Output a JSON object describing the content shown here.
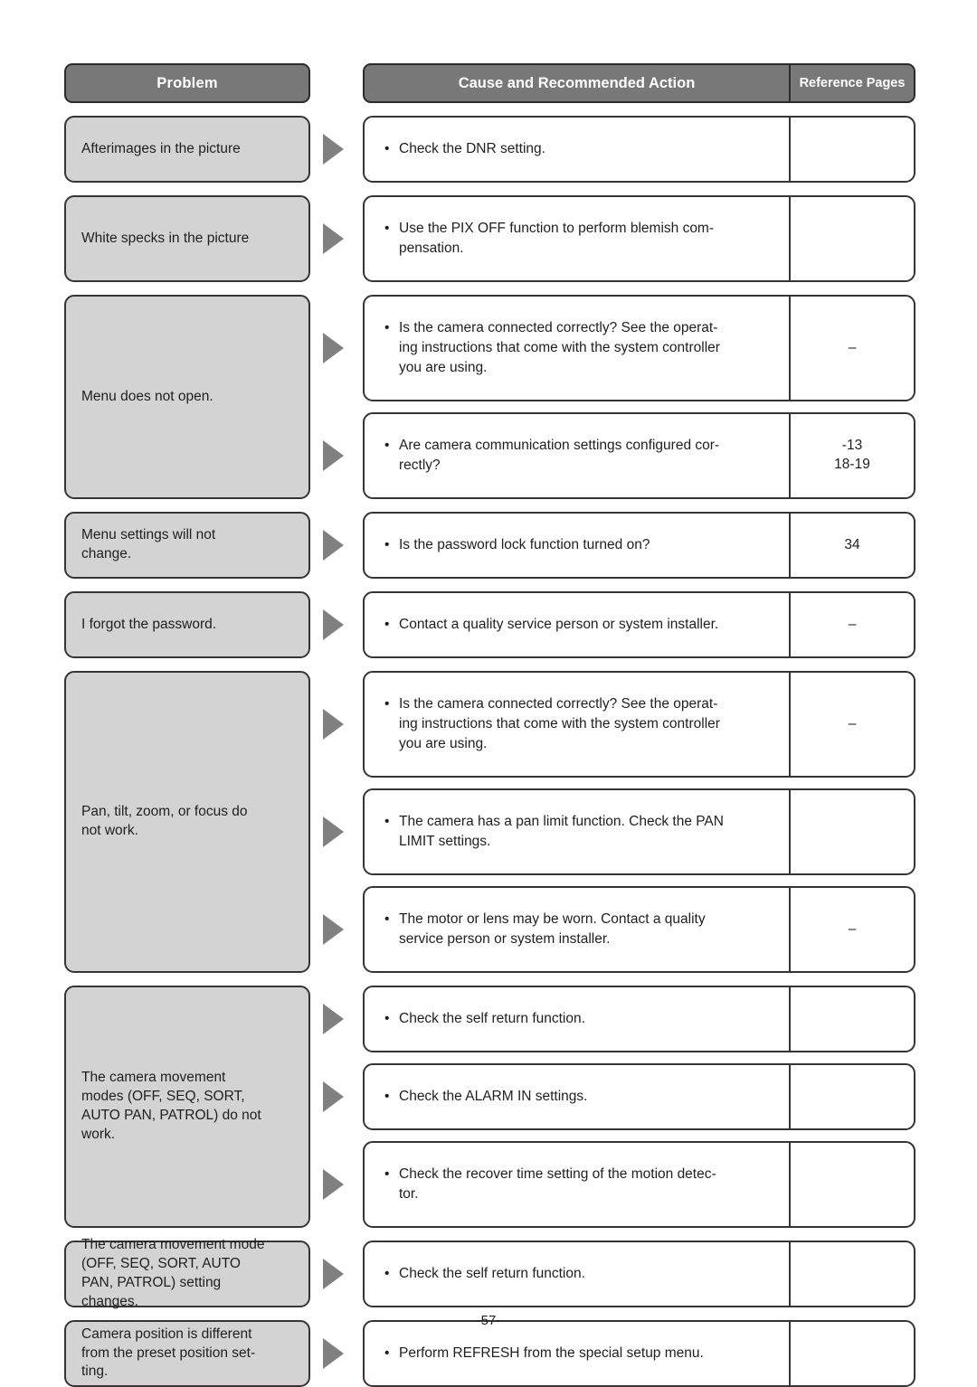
{
  "document": {
    "page_number": "-57-",
    "header": {
      "problem": "Problem",
      "cause": "Cause and Recommended Action",
      "reference": "Reference Pages"
    }
  },
  "colors": {
    "header_fill": "#787878",
    "header_text": "#ffffff",
    "problem_fill": "#d3d3d3",
    "border": "#3a3236",
    "arrow": "#808080",
    "body_text": "#1f1f1f"
  },
  "rows": [
    {
      "problem": "Afterimages in the picture",
      "actions": [
        {
          "text": "Check the DNR setting.",
          "reference": ""
        }
      ]
    },
    {
      "problem": "White specks in the picture",
      "actions": [
        {
          "text": "Use the PIX OFF function to perform blemish com-\npensation.",
          "reference": ""
        }
      ]
    },
    {
      "problem": "Menu does not open.",
      "actions": [
        {
          "text": "Is the camera connected correctly? See the operat-\ning instructions that come with the system controller\nyou are using.",
          "reference": "–"
        },
        {
          "text": "Are camera communication settings configured cor-\nrectly?",
          "reference": "-13\n18-19"
        }
      ]
    },
    {
      "problem": "Menu settings will not\nchange.",
      "actions": [
        {
          "text": "Is the password lock function turned on?",
          "reference": "34"
        }
      ]
    },
    {
      "problem": "I forgot the password.",
      "actions": [
        {
          "text": "Contact a quality service person or system installer.",
          "reference": "–"
        }
      ]
    },
    {
      "problem": "Pan, tilt, zoom, or focus do\nnot work.",
      "actions": [
        {
          "text": "Is the camera connected correctly? See the operat-\ning instructions that come with the system controller\nyou are using.",
          "reference": "–"
        },
        {
          "text": "The camera has a pan limit function. Check the PAN\nLIMIT settings.",
          "reference": ""
        },
        {
          "text": "The motor or lens may be worn. Contact a quality\nservice person or system installer.",
          "reference": "–"
        }
      ]
    },
    {
      "problem": "The camera movement\nmodes (OFF, SEQ, SORT,\nAUTO PAN, PATROL) do not\nwork.",
      "actions": [
        {
          "text": "Check the self return function.",
          "reference": ""
        },
        {
          "text": "Check the ALARM IN settings.",
          "reference": ""
        },
        {
          "text": "Check the recover time setting of the motion detec-\ntor.",
          "reference": ""
        }
      ]
    },
    {
      "problem": "The camera movement mode\n(OFF, SEQ, SORT, AUTO\nPAN, PATROL) setting\nchanges.",
      "actions": [
        {
          "text": "Check the self return function.",
          "reference": ""
        }
      ]
    },
    {
      "problem": "Camera position is different\nfrom the preset position set-\nting.",
      "actions": [
        {
          "text": "Perform REFRESH from the special setup menu.",
          "reference": ""
        }
      ]
    }
  ]
}
